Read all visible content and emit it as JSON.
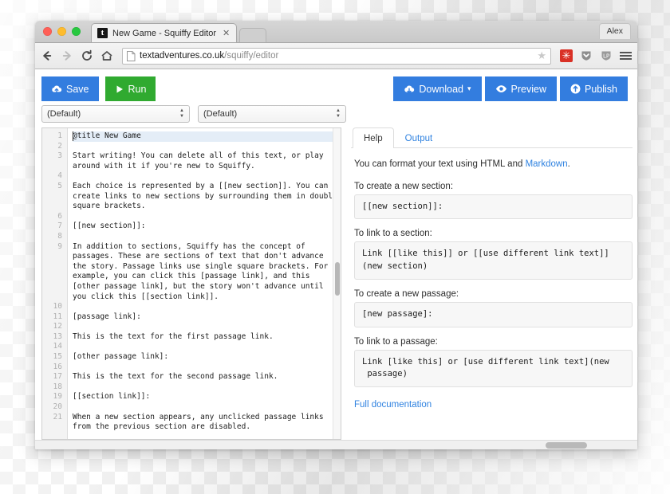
{
  "browser": {
    "tab": {
      "favicon_letter": "t",
      "title": "New Game - Squiffy Editor",
      "close_label": "✕"
    },
    "nav": {
      "back_icon": "back-arrow-icon",
      "forward_icon": "forward-arrow-icon",
      "reload_icon": "reload-icon",
      "home_icon": "home-icon",
      "url_domain": "textadventures.co.uk",
      "url_path": "/squiffy/editor",
      "star_icon": "★",
      "menu_icon": "hamburger-menu-icon"
    },
    "profile_label": "Alex"
  },
  "toolbar": {
    "save_label": "Save",
    "run_label": "Run",
    "download_label": "Download",
    "download_caret": "▾",
    "preview_label": "Preview",
    "publish_label": "Publish"
  },
  "selects": {
    "section_value": "(Default)",
    "passage_value": "(Default)",
    "arrow_up": "▲",
    "arrow_down": "▼"
  },
  "editor": {
    "line_numbers": [
      "1",
      "2",
      "3",
      "",
      "4",
      "5",
      "",
      "",
      "6",
      "7",
      "8",
      "9",
      "",
      "",
      "",
      "",
      "",
      "10",
      "11",
      "12",
      "13",
      "14",
      "15",
      "16",
      "17",
      "18",
      "19",
      "20",
      "21",
      ""
    ],
    "lines": [
      {
        "text": "@title New Game",
        "active": true
      },
      {
        "text": "",
        "active": false
      },
      {
        "text": "Start writing! You can delete all of this text, or play",
        "active": false
      },
      {
        "text": "around with it if you're new to Squiffy.",
        "active": false
      },
      {
        "text": "",
        "active": false
      },
      {
        "text": "Each choice is represented by a [[new section]]. You can",
        "active": false
      },
      {
        "text": "create links to new sections by surrounding them in double",
        "active": false
      },
      {
        "text": "square brackets.",
        "active": false
      },
      {
        "text": "",
        "active": false
      },
      {
        "text": "[[new section]]:",
        "active": false
      },
      {
        "text": "",
        "active": false
      },
      {
        "text": "In addition to sections, Squiffy has the concept of",
        "active": false
      },
      {
        "text": "passages. These are sections of text that don't advance",
        "active": false
      },
      {
        "text": "the story. Passage links use single square brackets. For",
        "active": false
      },
      {
        "text": "example, you can click this [passage link], and this",
        "active": false
      },
      {
        "text": "[other passage link], but the story won't advance until",
        "active": false
      },
      {
        "text": "you click this [[section link]].",
        "active": false
      },
      {
        "text": "",
        "active": false
      },
      {
        "text": "[passage link]:",
        "active": false
      },
      {
        "text": "",
        "active": false
      },
      {
        "text": "This is the text for the first passage link.",
        "active": false
      },
      {
        "text": "",
        "active": false
      },
      {
        "text": "[other passage link]:",
        "active": false
      },
      {
        "text": "",
        "active": false
      },
      {
        "text": "This is the text for the second passage link.",
        "active": false
      },
      {
        "text": "",
        "active": false
      },
      {
        "text": "[[section link]]:",
        "active": false
      },
      {
        "text": "",
        "active": false
      },
      {
        "text": "When a new section appears, any unclicked passage links",
        "active": false
      },
      {
        "text": "from the previous section are disabled.",
        "active": false
      }
    ]
  },
  "help": {
    "tabs": [
      {
        "label": "Help",
        "active": true
      },
      {
        "label": "Output",
        "active": false
      }
    ],
    "intro_before": "You can format your text using HTML and ",
    "intro_link": "Markdown",
    "intro_after": ".",
    "sections": [
      {
        "label": "To create a new section:",
        "code": "[[new section]]:"
      },
      {
        "label": "To link to a section:",
        "code": "Link [[like this]] or [[use different link text]]\n(new section)"
      },
      {
        "label": "To create a new passage:",
        "code": "[new passage]:"
      },
      {
        "label": "To link to a passage:",
        "code": "Link [like this] or [use different link text](new\n passage)"
      }
    ],
    "full_doc_link": "Full documentation"
  },
  "colors": {
    "primary_blue": "#337ddf",
    "run_green": "#30aa30",
    "link_blue": "#2f82e0",
    "extension_red": "#d93025"
  }
}
